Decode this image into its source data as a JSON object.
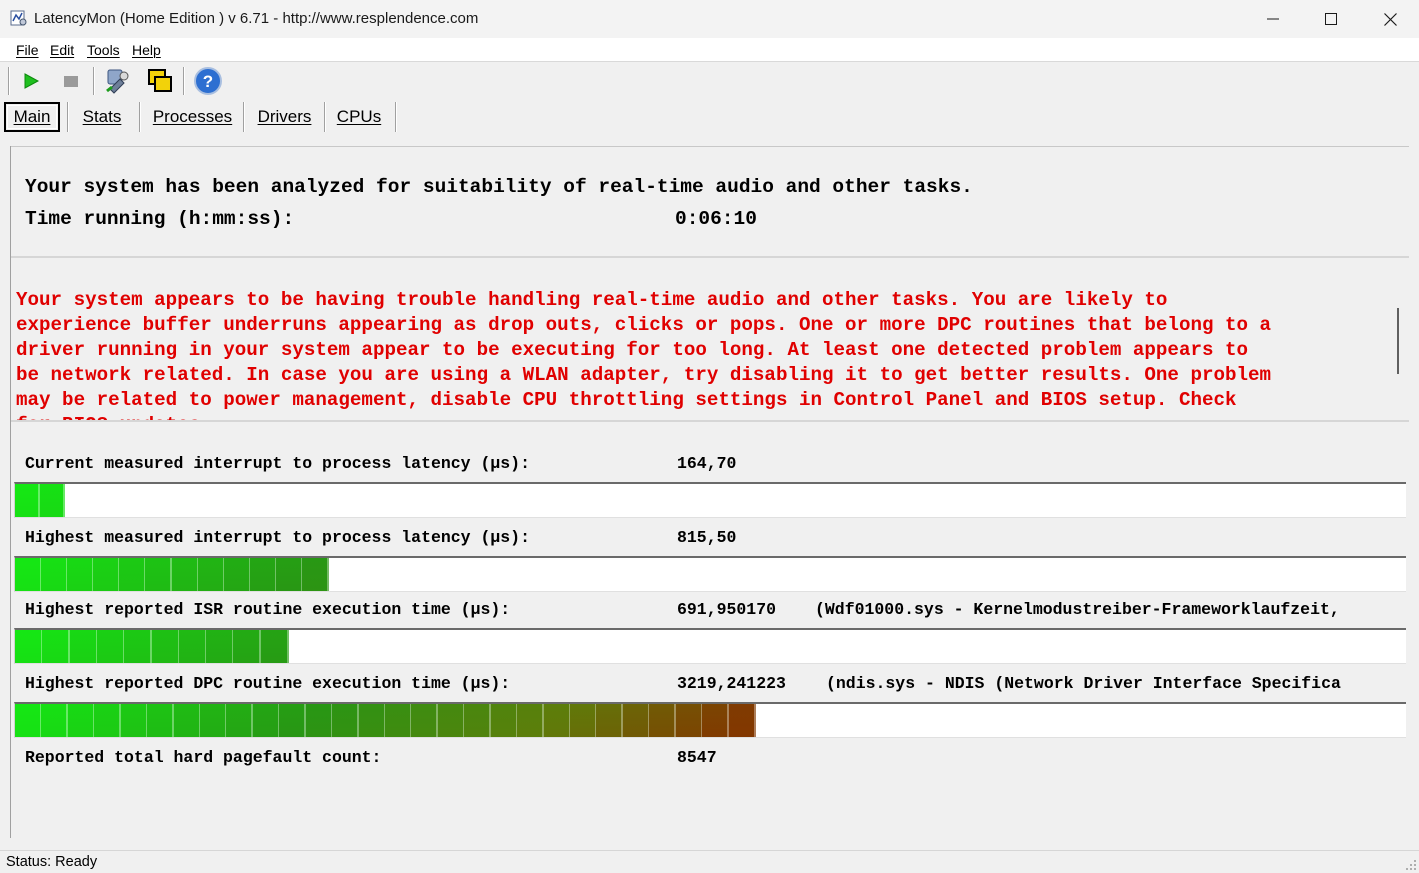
{
  "window": {
    "title": "LatencyMon  (Home Edition )  v 6.71 - http://www.resplendence.com"
  },
  "menu": {
    "file": "File",
    "edit": "Edit",
    "tools": "Tools",
    "help": "Help"
  },
  "toolbar": {
    "start_icon": "play-icon",
    "stop_icon": "stop-icon",
    "settings_icon": "settings-icon",
    "windows_icon": "windows-icon",
    "help_icon": "help-icon"
  },
  "tabs": [
    {
      "label": "Main",
      "active": true
    },
    {
      "label": "Stats",
      "active": false
    },
    {
      "label": "Processes",
      "active": false
    },
    {
      "label": "Drivers",
      "active": false
    },
    {
      "label": "CPUs",
      "active": false
    }
  ],
  "summary": {
    "line1": "Your system has been analyzed for suitability of real-time audio and other tasks.",
    "time_label": "Time running (h:mm:ss):",
    "time_value": "0:06:10"
  },
  "warning": {
    "text": "Your system appears to be having trouble handling real-time audio and other tasks. You are likely to\nexperience buffer underruns appearing as drop outs, clicks or pops. One or more DPC routines that belong to a\ndriver running in your system appear to be executing for too long. At least one detected problem appears to\nbe network related. In case you are using a WLAN adapter, try disabling it to get better results. One problem\nmay be related to power management, disable CPU throttling settings in Control Panel and BIOS setup. Check\nfor BIOS updates.",
    "color": "#e00000"
  },
  "metrics": [
    {
      "label": "Current measured interrupt to process latency (µs):",
      "value": "164,70",
      "extra": "",
      "level": 0.036
    },
    {
      "label": "Highest measured interrupt to process latency (µs):",
      "value": "815,50",
      "extra": "",
      "level": 0.225
    },
    {
      "label": "Highest reported ISR routine execution time (µs):",
      "value": "691,950170",
      "extra": "(Wdf01000.sys - Kernelmodustreiber-Frameworklaufzeit,",
      "level": 0.196
    },
    {
      "label": "Highest reported DPC routine execution time (µs):",
      "value": "3219,241223",
      "extra": "(ndis.sys - NDIS (Network Driver Interface Specifica",
      "level": 0.532
    }
  ],
  "pagefault": {
    "label": "Reported total hard pagefault count:",
    "value": "8547"
  },
  "status": {
    "text": "Status: Ready"
  }
}
